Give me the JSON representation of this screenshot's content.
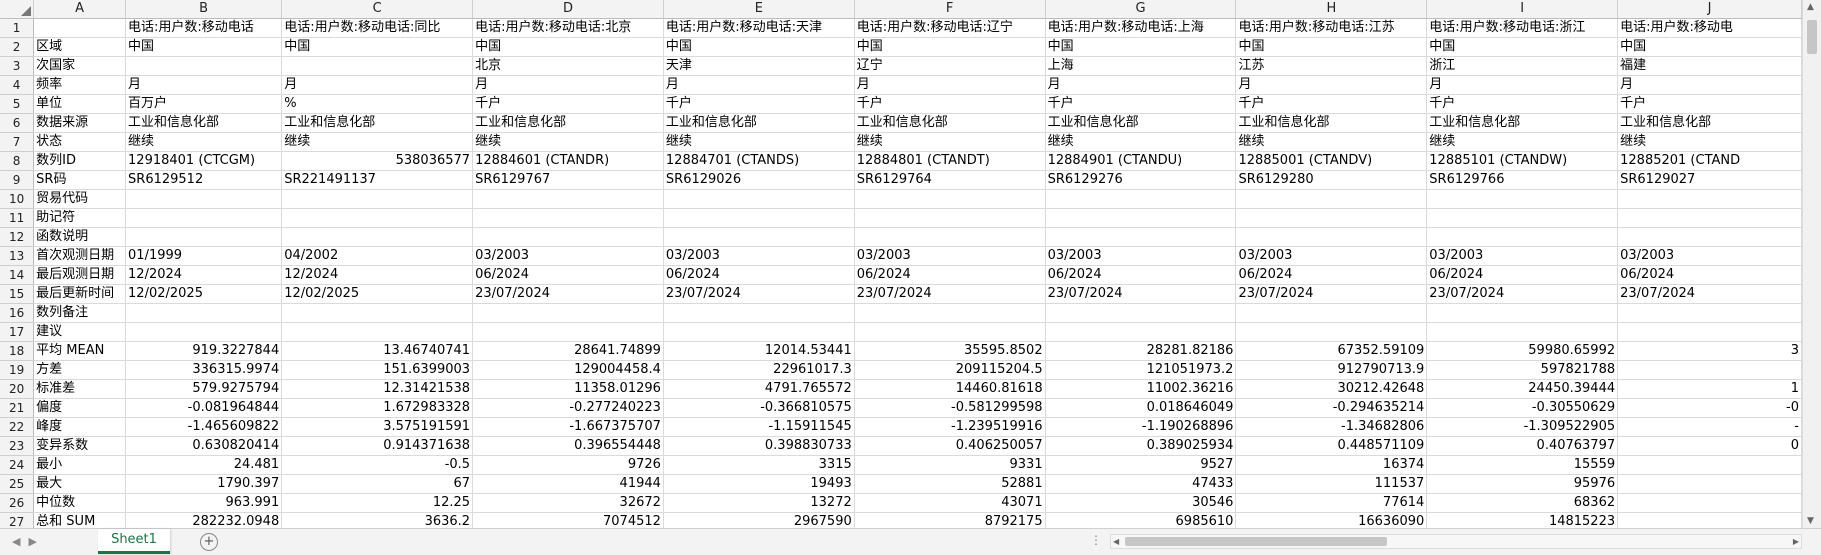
{
  "columns": [
    "A",
    "B",
    "C",
    "D",
    "E",
    "F",
    "G",
    "H",
    "I",
    "J"
  ],
  "rows": [
    {
      "n": "1",
      "cells": [
        "",
        "电话:用户数:移动电话",
        "电话:用户数:移动电话:同比",
        "电话:用户数:移动电话:北京",
        "电话:用户数:移动电话:天津",
        "电话:用户数:移动电话:辽宁",
        "电话:用户数:移动电话:上海",
        "电话:用户数:移动电话:江苏",
        "电话:用户数:移动电话:浙江",
        "电话:用户数:移动电"
      ]
    },
    {
      "n": "2",
      "cells": [
        "区域",
        "中国",
        "中国",
        "中国",
        "中国",
        "中国",
        "中国",
        "中国",
        "中国",
        "中国"
      ]
    },
    {
      "n": "3",
      "cells": [
        "次国家",
        "",
        "",
        "北京",
        "天津",
        "辽宁",
        "上海",
        "江苏",
        "浙江",
        "福建"
      ]
    },
    {
      "n": "4",
      "cells": [
        "频率",
        "月",
        "月",
        "月",
        "月",
        "月",
        "月",
        "月",
        "月",
        "月"
      ]
    },
    {
      "n": "5",
      "cells": [
        "单位",
        "百万户",
        "%",
        "千户",
        "千户",
        "千户",
        "千户",
        "千户",
        "千户",
        "千户"
      ]
    },
    {
      "n": "6",
      "cells": [
        "数据来源",
        "工业和信息化部",
        "工业和信息化部",
        "工业和信息化部",
        "工业和信息化部",
        "工业和信息化部",
        "工业和信息化部",
        "工业和信息化部",
        "工业和信息化部",
        "工业和信息化部"
      ]
    },
    {
      "n": "7",
      "cells": [
        "状态",
        "继续",
        "继续",
        "继续",
        "继续",
        "继续",
        "继续",
        "继续",
        "继续",
        "继续"
      ]
    },
    {
      "n": "8",
      "cells": [
        "数列ID",
        "12918401 (CTCGM)",
        "538036577",
        "12884601 (CTANDR)",
        "12884701 (CTANDS)",
        "12884801 (CTANDT)",
        "12884901 (CTANDU)",
        "12885001 (CTANDV)",
        "12885101 (CTANDW)",
        "12885201 (CTAND"
      ]
    },
    {
      "n": "9",
      "cells": [
        "SR码",
        "SR6129512",
        "SR221491137",
        "SR6129767",
        "SR6129026",
        "SR6129764",
        "SR6129276",
        "SR6129280",
        "SR6129766",
        "SR6129027"
      ]
    },
    {
      "n": "10",
      "cells": [
        "贸易代码",
        "",
        "",
        "",
        "",
        "",
        "",
        "",
        "",
        ""
      ]
    },
    {
      "n": "11",
      "cells": [
        "助记符",
        "",
        "",
        "",
        "",
        "",
        "",
        "",
        "",
        ""
      ]
    },
    {
      "n": "12",
      "cells": [
        "函数说明",
        "",
        "",
        "",
        "",
        "",
        "",
        "",
        "",
        ""
      ]
    },
    {
      "n": "13",
      "cells": [
        "首次观测日期",
        "01/1999",
        "04/2002",
        "03/2003",
        "03/2003",
        "03/2003",
        "03/2003",
        "03/2003",
        "03/2003",
        "03/2003"
      ]
    },
    {
      "n": "14",
      "cells": [
        "最后观测日期",
        "12/2024",
        "12/2024",
        "06/2024",
        "06/2024",
        "06/2024",
        "06/2024",
        "06/2024",
        "06/2024",
        "06/2024"
      ]
    },
    {
      "n": "15",
      "cells": [
        "最后更新时间",
        "12/02/2025",
        "12/02/2025",
        "23/07/2024",
        "23/07/2024",
        "23/07/2024",
        "23/07/2024",
        "23/07/2024",
        "23/07/2024",
        "23/07/2024"
      ]
    },
    {
      "n": "16",
      "cells": [
        "数列备注",
        "",
        "",
        "",
        "",
        "",
        "",
        "",
        "",
        ""
      ]
    },
    {
      "n": "17",
      "cells": [
        "建议",
        "",
        "",
        "",
        "",
        "",
        "",
        "",
        "",
        ""
      ]
    },
    {
      "n": "18",
      "cells": [
        "平均 MEAN",
        "919.3227844",
        "13.46740741",
        "28641.74899",
        "12014.53441",
        "35595.8502",
        "28281.82186",
        "67352.59109",
        "59980.65992",
        "3"
      ]
    },
    {
      "n": "19",
      "cells": [
        "方差",
        "336315.9974",
        "151.6399003",
        "129004458.4",
        "22961017.3",
        "209115204.5",
        "121051973.2",
        "912790713.9",
        "597821788",
        ""
      ]
    },
    {
      "n": "20",
      "cells": [
        "标准差",
        "579.9275794",
        "12.31421538",
        "11358.01296",
        "4791.765572",
        "14460.81618",
        "11002.36216",
        "30212.42648",
        "24450.39444",
        "1"
      ]
    },
    {
      "n": "21",
      "cells": [
        "偏度",
        "-0.081964844",
        "1.672983328",
        "-0.277240223",
        "-0.366810575",
        "-0.581299598",
        "0.018646049",
        "-0.294635214",
        "-0.30550629",
        "-0"
      ]
    },
    {
      "n": "22",
      "cells": [
        "峰度",
        "-1.465609822",
        "3.575191591",
        "-1.667375707",
        "-1.15911545",
        "-1.239519916",
        "-1.190268896",
        "-1.34682806",
        "-1.309522905",
        "-"
      ]
    },
    {
      "n": "23",
      "cells": [
        "变异系数",
        "0.630820414",
        "0.914371638",
        "0.396554448",
        "0.398830733",
        "0.406250057",
        "0.389025934",
        "0.448571109",
        "0.40763797",
        "0"
      ]
    },
    {
      "n": "24",
      "cells": [
        "最小",
        "24.481",
        "-0.5",
        "9726",
        "3315",
        "9331",
        "9527",
        "16374",
        "15559",
        ""
      ]
    },
    {
      "n": "25",
      "cells": [
        "最大",
        "1790.397",
        "67",
        "41944",
        "19493",
        "52881",
        "47433",
        "111537",
        "95976",
        ""
      ]
    },
    {
      "n": "26",
      "cells": [
        "中位数",
        "963.991",
        "12.25",
        "32672",
        "13272",
        "43071",
        "30546",
        "77614",
        "68362",
        ""
      ]
    },
    {
      "n": "27",
      "cells": [
        "总和 SUM",
        "282232.0948",
        "3636.2",
        "7074512",
        "2967590",
        "8792175",
        "6985610",
        "16636090",
        "14815223",
        ""
      ]
    }
  ],
  "numeric_rows_from": 18,
  "numeric_cells_right_align_extra": [
    [
      "8",
      2
    ]
  ],
  "sheet_tab": "Sheet1",
  "add_sheet_icon": "plus-circle-icon",
  "accent_color": "#217346"
}
